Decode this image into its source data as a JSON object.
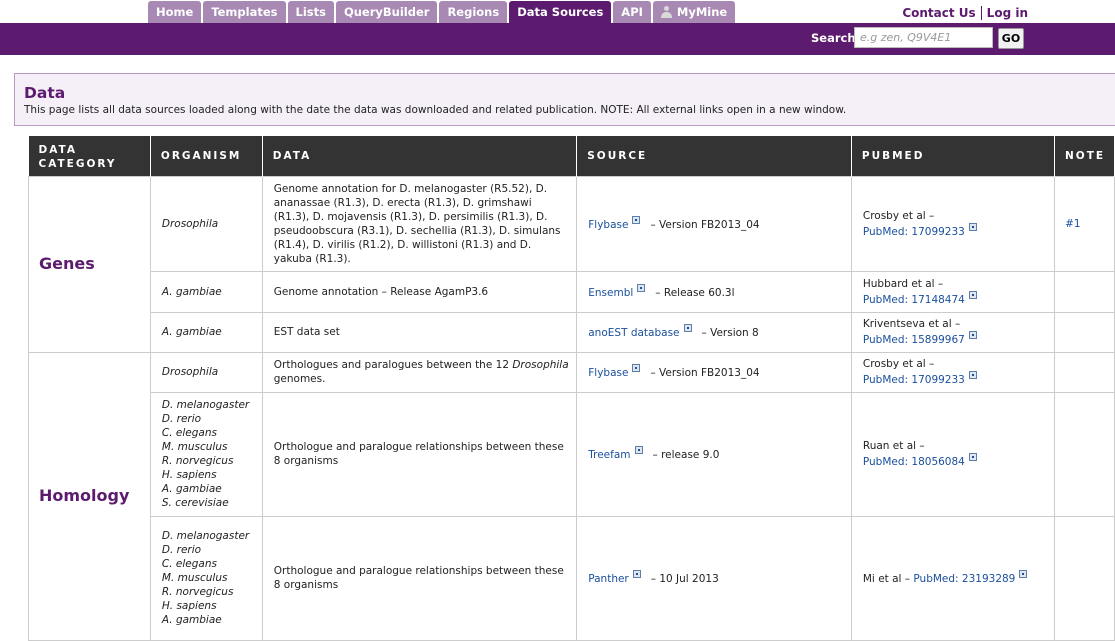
{
  "nav": {
    "tabs": [
      {
        "label": "Home"
      },
      {
        "label": "Templates"
      },
      {
        "label": "Lists"
      },
      {
        "label": "QueryBuilder"
      },
      {
        "label": "Regions"
      },
      {
        "label": "Data Sources"
      },
      {
        "label": "API"
      },
      {
        "label": "MyMine"
      }
    ],
    "contact_label": "Contact Us",
    "login_label": "Log in"
  },
  "search": {
    "label": "Search:",
    "placeholder": "e.g zen, Q9V4E1",
    "go_label": "GO"
  },
  "info": {
    "title": "Data",
    "description": "This page lists all data sources loaded along with the date the data was downloaded and related publication. NOTE: All external links open in a new window."
  },
  "table": {
    "headers": {
      "category": "DATA CATEGORY",
      "organism": "ORGANISM",
      "data": "DATA",
      "source": "SOURCE",
      "pubmed": "PUBMED",
      "note": "NOTE"
    },
    "categories": {
      "genes": "Genes",
      "homology": "Homology"
    },
    "rows": [
      {
        "organism": [
          "Drosophila"
        ],
        "data_prefix": "Genome annotation for D. melanogaster (R5.52), D. ananassae (R1.3), D. erecta (R1.3), D. grimshawi (R1.3), D. mojavensis (R1.3), D. persimilis (R1.3), D. pseudoobscura (R3.1), D. sechellia (R1.3), D. simulans (R1.4), D. virilis (R1.2), D. willistoni (R1.3) and D. yakuba (R1.3).",
        "source": "Flybase",
        "source_version": "– Version FB2013_04",
        "pub_author": "Crosby et al –",
        "pub_link": "PubMed: 17099233",
        "note": "#1"
      },
      {
        "organism": [
          "A. gambiae"
        ],
        "data_prefix": "Genome annotation – Release AgamP3.6",
        "source": "Ensembl",
        "source_version": "– Release 60.3l",
        "pub_author": "Hubbard et al –",
        "pub_link": "PubMed: 17148474",
        "note": ""
      },
      {
        "organism": [
          "A. gambiae"
        ],
        "data_prefix": "EST data set",
        "source": "anoEST database",
        "source_version": "– Version 8",
        "pub_author": "Kriventseva et al –",
        "pub_link": "PubMed: 15899967",
        "note": ""
      },
      {
        "organism": [
          "Drosophila"
        ],
        "data_prefix": "Orthologues and paralogues between the 12 ",
        "data_italic": "Drosophila",
        "data_suffix": " genomes.",
        "source": "Flybase",
        "source_version": "– Version FB2013_04",
        "pub_author": "Crosby et al –",
        "pub_link": "PubMed: 17099233",
        "note": ""
      },
      {
        "organism": [
          "D. melanogaster",
          "D. rerio",
          "C. elegans",
          "M. musculus",
          "R. norvegicus",
          "H. sapiens",
          "A. gambiae",
          "S. cerevisiae"
        ],
        "data_prefix": "Orthologue and paralogue relationships between these 8 organisms",
        "source": "Treefam",
        "source_version": "– release 9.0",
        "pub_author": "Ruan et al –",
        "pub_link": "PubMed: 18056084",
        "note": ""
      },
      {
        "organism": [
          "D. melanogaster",
          "D. rerio",
          "C. elegans",
          "M. musculus",
          "R. norvegicus",
          "H. sapiens",
          "A. gambiae"
        ],
        "data_prefix": "Orthologue and paralogue relationships between these 8 organisms",
        "source": "Panther",
        "source_version": "– 10 Jul 2013",
        "pub_author": "Mi et al –",
        "pub_link": "PubMed: 23193289",
        "note": ""
      }
    ]
  },
  "colors": {
    "brand_purple": "#5c1b6e",
    "tab_inactive": "#a889b4",
    "header_dark": "#333333",
    "link_blue": "#1a4f9c"
  }
}
